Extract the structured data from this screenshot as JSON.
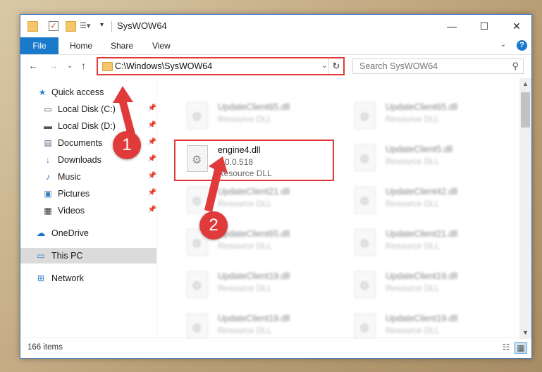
{
  "window": {
    "title": "SysWOW64",
    "controls": {
      "minimize": "—",
      "maximize": "☐",
      "close": "✕"
    }
  },
  "ribbon": {
    "tabs": [
      "File",
      "Home",
      "Share",
      "View"
    ],
    "help": "?"
  },
  "address": {
    "path": "C:\\Windows\\SysWOW64",
    "dropdown": "⌄",
    "refresh": "↻"
  },
  "search": {
    "placeholder": "Search SysWOW64",
    "icon": "search-icon"
  },
  "sidebar": {
    "items": [
      {
        "label": "Quick access",
        "icon": "star-icon",
        "pinned": false
      },
      {
        "label": "Local Disk (C:)",
        "icon": "drive-c-icon",
        "pinned": true
      },
      {
        "label": "Local Disk (D:)",
        "icon": "drive-d-icon",
        "pinned": true
      },
      {
        "label": "Documents",
        "icon": "documents-icon",
        "pinned": true
      },
      {
        "label": "Downloads",
        "icon": "downloads-icon",
        "pinned": true
      },
      {
        "label": "Music",
        "icon": "music-icon",
        "pinned": true
      },
      {
        "label": "Pictures",
        "icon": "pictures-icon",
        "pinned": true
      },
      {
        "label": "Videos",
        "icon": "videos-icon",
        "pinned": true
      },
      {
        "label": "OneDrive",
        "icon": "onedrive-icon",
        "pinned": false
      },
      {
        "label": "This PC",
        "icon": "this-pc-icon",
        "pinned": false,
        "selected": true
      },
      {
        "label": "Network",
        "icon": "network-icon",
        "pinned": false
      }
    ]
  },
  "files": {
    "highlighted": {
      "name": "engine4.dll",
      "version": "6.0.0.518",
      "type": "Resource DLL"
    },
    "left_column": [
      {
        "name": "UpdateClient65.dll",
        "type": "Resource DLL"
      },
      {
        "name": "UpdateClient21.dll",
        "type": "Resource DLL"
      },
      {
        "name": "UpdateClient65.dll",
        "type": "Resource DLL"
      },
      {
        "name": "UpdateClient19.dll",
        "type": "Resource DLL"
      },
      {
        "name": "UpdateClient19.dll",
        "type": "Resource DLL"
      }
    ],
    "right_column": [
      {
        "name": "UpdateClient65.dll",
        "type": "Resource DLL"
      },
      {
        "name": "UpdateClient5.dll",
        "type": "Resource DLL"
      },
      {
        "name": "UpdateClient42.dll",
        "type": "Resource DLL"
      },
      {
        "name": "UpdateClient21.dll",
        "type": "Resource DLL"
      },
      {
        "name": "UpdateClient19.dll",
        "type": "Resource DLL"
      },
      {
        "name": "UpdateClient19.dll",
        "type": "Resource DLL"
      }
    ]
  },
  "status": {
    "item_count": "166 items"
  },
  "annotations": {
    "step1": "1",
    "step2": "2",
    "color": "#e03a3a"
  }
}
